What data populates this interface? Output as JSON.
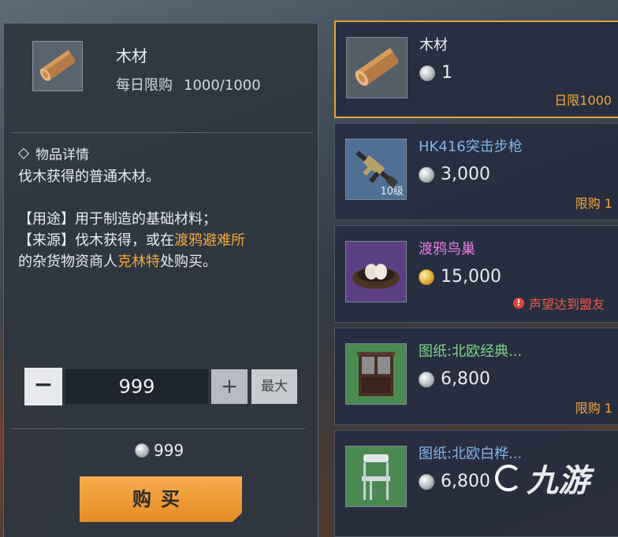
{
  "detail": {
    "item_name": "木材",
    "limit_label": "每日限购",
    "limit_value": "1000/1000",
    "section_title": "物品详情",
    "desc_line1": "伐木获得的普通木材。",
    "usage_prefix": "【用途】",
    "usage_text": "用于制造的基础材料；",
    "source_prefix": "【来源】",
    "source_text_a": "伐木获得，或在",
    "source_place": "渡鸦避难所",
    "source_text_b": "的杂货物资商人",
    "source_npc": "克林特",
    "source_text_c": "处购买。",
    "quantity": "999",
    "minus_label": "−",
    "plus_label": "+",
    "max_label": "最大",
    "total_price": "999",
    "buy_label": "购买"
  },
  "shop_items": [
    {
      "name": "木材",
      "price": "1",
      "currency": "silver",
      "tag": "日限1000",
      "selected": true,
      "icon": "wood-log-icon"
    },
    {
      "name": "HK416突击步枪",
      "price": "3,000",
      "currency": "silver",
      "tag": "限购 1",
      "level_badge": "10级",
      "icon": "rifle-icon"
    },
    {
      "name": "渡鸦鸟巢",
      "price": "15,000",
      "currency": "gold",
      "warning": "声望达到盟友",
      "icon": "bird-nest-icon"
    },
    {
      "name": "图纸:北欧经典...",
      "price": "6,800",
      "currency": "silver",
      "tag": "限购 1",
      "icon": "cabinet-icon"
    },
    {
      "name": "图纸:北欧白桦...",
      "price": "6,800",
      "currency": "silver",
      "icon": "chair-icon"
    }
  ],
  "watermark": "九游",
  "colors": {
    "accent_orange": "#f4a73a",
    "warning_red": "#ef5a4a",
    "selected_border": "#e6a436"
  }
}
